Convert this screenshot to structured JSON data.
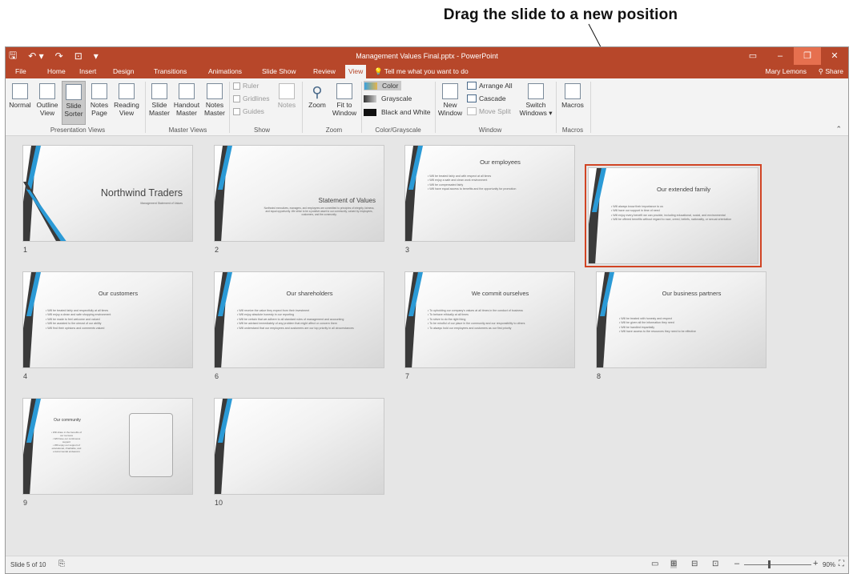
{
  "callout": "Drag the slide to a new position",
  "window": {
    "title": "Management Values Final.pptx - PowerPoint",
    "controls": [
      "▭",
      "–",
      "❐",
      "✕"
    ]
  },
  "qat": {
    "save": "🖫",
    "undo": "↶ ▾",
    "redo": "↷",
    "present": "⊡",
    "more": "▾"
  },
  "tabs": [
    "File",
    "Home",
    "Insert",
    "Design",
    "Transitions",
    "Animations",
    "Slide Show",
    "Review",
    "View"
  ],
  "tell_me": "Tell me what you want to do",
  "user": "Mary Lemons",
  "share": "Share",
  "ribbon": {
    "presentation_views": {
      "label": "Presentation Views",
      "items": [
        [
          "Normal",
          ""
        ],
        [
          "Outline",
          "View"
        ],
        [
          "Slide",
          "Sorter"
        ],
        [
          "Notes",
          "Page"
        ],
        [
          "Reading",
          "View"
        ]
      ]
    },
    "master_views": {
      "label": "Master Views",
      "items": [
        [
          "Slide",
          "Master"
        ],
        [
          "Handout",
          "Master"
        ],
        [
          "Notes",
          "Master"
        ]
      ]
    },
    "show": {
      "label": "Show",
      "ruler": "Ruler",
      "gridlines": "Gridlines",
      "guides": "Guides",
      "notes": "Notes"
    },
    "zoom": {
      "label": "Zoom",
      "zoom": "Zoom",
      "fit": [
        "Fit to",
        "Window"
      ]
    },
    "color": {
      "label": "Color/Grayscale",
      "color": "Color",
      "grayscale": "Grayscale",
      "bw": "Black and White"
    },
    "window": {
      "label": "Window",
      "new": [
        "New",
        "Window"
      ],
      "arrange": "Arrange All",
      "cascade": "Cascade",
      "move_split": "Move Split",
      "switch": [
        "Switch",
        "Windows ▾"
      ]
    },
    "macros": {
      "label": "Macros",
      "macros": "Macros"
    }
  },
  "slides": [
    {
      "num": "1",
      "title": "Northwind Traders",
      "subtitle": "Management Statement of Values",
      "bullets": []
    },
    {
      "num": "2",
      "title": "Statement of Values",
      "subtitle": "Northwind executives, managers, and employees are committed to principles of integrity, fairness, and equal opportunity. We strive to be a positive asset to our community, valued by employees, customers, and the community.",
      "bullets": []
    },
    {
      "num": "3",
      "title": "Our employees",
      "subtitle": "",
      "bullets": [
        "Will be treated fairly and with respect at all times",
        "Will enjoy a safe and clean work environment",
        "Will be compensated fairly",
        "Will have equal access to benefits and the opportunity for promotion"
      ]
    },
    {
      "num": "",
      "title": "Our extended family",
      "subtitle": "",
      "bullets": [
        "Will always know their importance to us",
        "Will have our support in time of need",
        "Will enjoy every benefit we can provide, including educational, social, and environmental",
        "Will be offered benefits without regard to race, creed, beliefs, nationality, or sexual orientation"
      ]
    },
    {
      "num": "4",
      "title": "Our customers",
      "subtitle": "",
      "bullets": [
        "Will be treated fairly and respectfully at all times",
        "Will enjoy a clean and safe shopping environment",
        "Will be made to feel welcome and valued",
        "Will be assisted to the utmost of our ability",
        "Will find their opinions and comments valued"
      ]
    },
    {
      "num": "6",
      "title": "Our shareholders",
      "subtitle": "",
      "bullets": [
        "Will receive the value they expect from their investment",
        "Will enjoy absolute honesty in our reporting",
        "Will be certain that we adhere to all standard rules of management and accounting",
        "Will be advised immediately of any problem that might affect or concern them",
        "Will understand that our employees and customers are our top priority in all circumstances"
      ]
    },
    {
      "num": "7",
      "title": "We commit ourselves",
      "subtitle": "",
      "bullets": [
        "To upholding our company's values at all times in the conduct of business",
        "To behave ethically at all times",
        "To strive to do the right thing",
        "To be mindful of our place in the community and our responsibility to others",
        "To always hold our employees and customers as our first priority"
      ]
    },
    {
      "num": "8",
      "title": "Our business partners",
      "subtitle": "",
      "bullets": [
        "Will be treated with honesty and respect",
        "Will be given all the information they need",
        "Will be handled impartially",
        "Will have access to the resources they need to be effective"
      ]
    },
    {
      "num": "9",
      "title": "Our community",
      "subtitle": "",
      "bullets": [
        "Will share in the benefits of our success",
        "Will have our continuous support",
        "Will enjoy our support of educational, charitable, and environmental endeavors"
      ]
    },
    {
      "num": "10",
      "title": "",
      "subtitle": "",
      "bullets": []
    }
  ],
  "status": {
    "slide": "Slide 5 of 10",
    "zoom": "90%"
  }
}
